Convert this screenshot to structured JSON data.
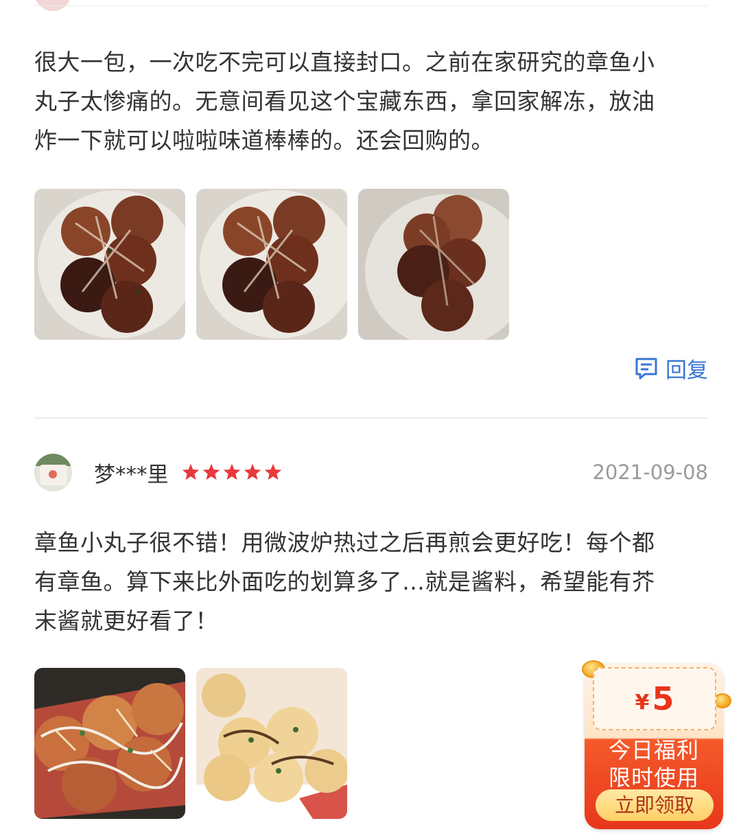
{
  "review1": {
    "lines": [
      "很大一包，一次吃不完可以直接封口。之前在家研究的章鱼小",
      "丸子太惨痛的。无意间看见这个宝藏东西，拿回家解冻，放油",
      "炸一下就可以啦啦味道棒棒的。还会回购的。"
    ],
    "reply_label": "回复"
  },
  "review2": {
    "username": "梦***里",
    "rating": 5,
    "date": "2021-09-08",
    "lines": [
      "章鱼小丸子很不错！用微波炉热过之后再煎会更好吃！每个都",
      "有章鱼。算下来比外面吃的划算多了…就是酱料，希望能有芥",
      "末酱就更好看了！"
    ]
  },
  "coupon": {
    "currency": "¥",
    "amount": "5",
    "line1": "今日福利",
    "line2": "限时使用",
    "button": "立即领取"
  },
  "icons": {
    "reply": "comment-icon",
    "star": "star-icon"
  },
  "colors": {
    "accent_blue": "#3875d6",
    "star_red": "#e8393c",
    "coupon_red": "#e8371c"
  }
}
